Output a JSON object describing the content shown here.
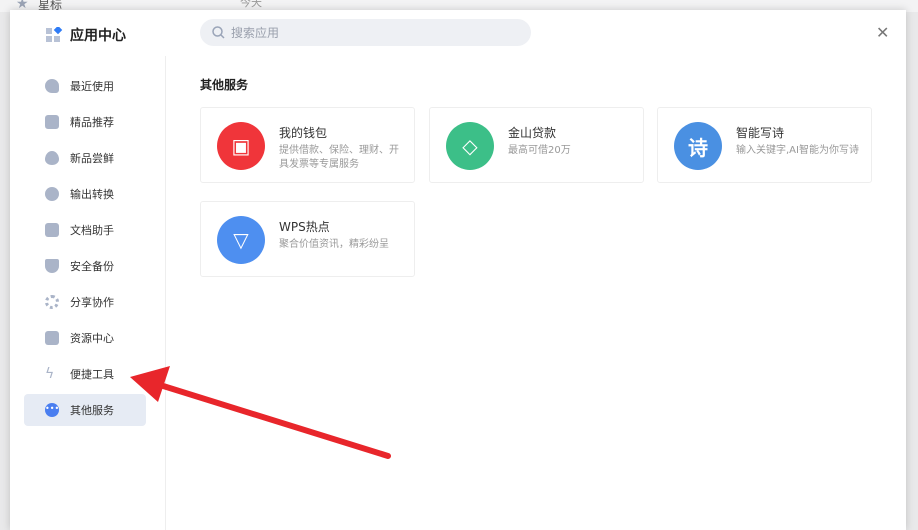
{
  "background": {
    "tab_label": "星标",
    "date_label": "今天"
  },
  "header": {
    "title": "应用中心",
    "search_placeholder": "搜索应用"
  },
  "sidebar": {
    "items": [
      {
        "label": "最近使用",
        "icon": "heart-icon"
      },
      {
        "label": "精品推荐",
        "icon": "diamond-icon"
      },
      {
        "label": "新品尝鲜",
        "icon": "flame-icon"
      },
      {
        "label": "输出转换",
        "icon": "convert-icon"
      },
      {
        "label": "文档助手",
        "icon": "document-icon"
      },
      {
        "label": "安全备份",
        "icon": "shield-icon"
      },
      {
        "label": "分享协作",
        "icon": "share-icon"
      },
      {
        "label": "资源中心",
        "icon": "briefcase-icon"
      },
      {
        "label": "便捷工具",
        "icon": "lightning-icon"
      },
      {
        "label": "其他服务",
        "icon": "more-icon",
        "active": true
      }
    ]
  },
  "main": {
    "section_title": "其他服务",
    "cards": [
      {
        "name": "我的钱包",
        "desc": "提供借款、保险、理财、开具发票等专属服务",
        "color": "#f0353a",
        "glyph": "▣"
      },
      {
        "name": "金山贷款",
        "desc": "最高可借20万",
        "color": "#3cbf88",
        "glyph": "◇"
      },
      {
        "name": "智能写诗",
        "desc": "输入关键字,AI智能为你写诗",
        "color": "#4a90e2",
        "glyph": "诗"
      },
      {
        "name": "WPS热点",
        "desc": "聚合价值资讯，精彩纷呈",
        "color": "#4e8ff0",
        "glyph": "▽"
      }
    ]
  }
}
